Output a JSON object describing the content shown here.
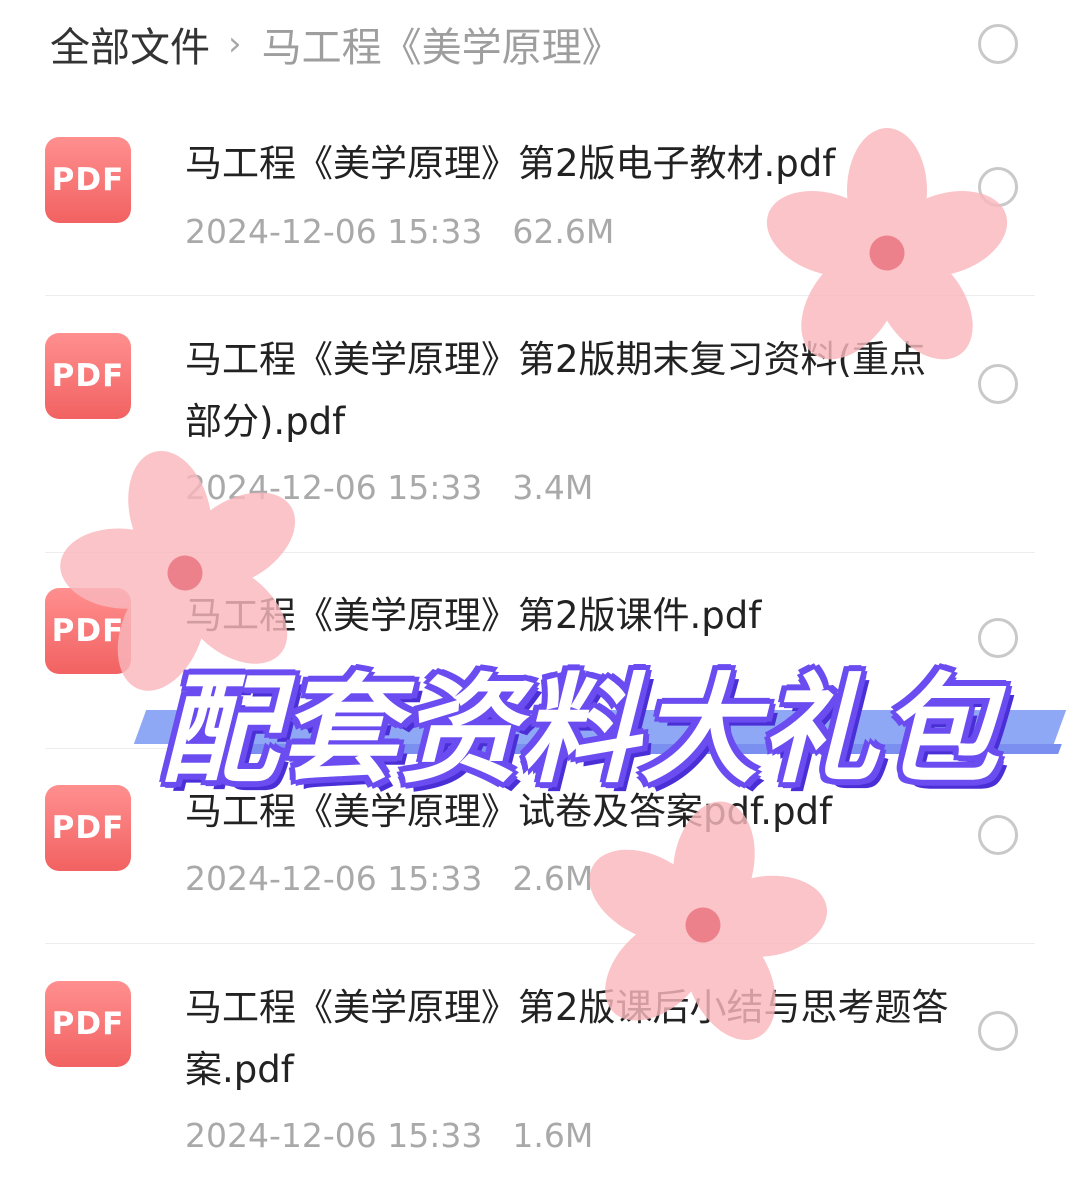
{
  "breadcrumb": {
    "root": "全部文件",
    "separator": "›",
    "current": "马工程《美学原理》"
  },
  "files": [
    {
      "icon_label": "PDF",
      "name": "马工程《美学原理》第2版电子教材.pdf",
      "date": "2024-12-06 15:33",
      "size": "62.6M"
    },
    {
      "icon_label": "PDF",
      "name": "马工程《美学原理》第2版期末复习资料(重点部分).pdf",
      "date": "2024-12-06 15:33",
      "size": "3.4M"
    },
    {
      "icon_label": "PDF",
      "name": "马工程《美学原理》第2版课件.pdf",
      "date": "",
      "size": ""
    },
    {
      "icon_label": "PDF",
      "name": "马工程《美学原理》试卷及答案pdf.pdf",
      "date": "2024-12-06 15:33",
      "size": "2.6M"
    },
    {
      "icon_label": "PDF",
      "name": "马工程《美学原理》第2版课后小结与思考题答案.pdf",
      "date": "2024-12-06 15:33",
      "size": "1.6M"
    }
  ],
  "banner": {
    "text": "配套资料大礼包"
  },
  "colors": {
    "pdf_icon": "#f26262",
    "banner_outline": "#6a4cf0",
    "banner_stripe": "#8fa8f5",
    "flower": "#f9b8bd"
  }
}
